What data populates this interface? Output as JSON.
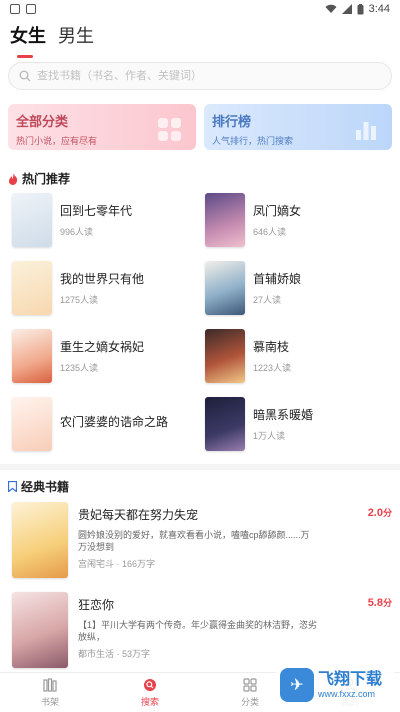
{
  "status_bar": {
    "time": "3:44"
  },
  "gender_tabs": [
    {
      "label": "女生",
      "active": true
    },
    {
      "label": "男生",
      "active": false
    }
  ],
  "search": {
    "placeholder": "查找书籍（书名、作者、关键词）"
  },
  "category_cards": [
    {
      "title": "全部分类",
      "subtitle": "热门小说，应有尽有",
      "color": "#fcc6ce"
    },
    {
      "title": "排行榜",
      "subtitle": "人气排行，热门搜索",
      "color": "#bcd6fa"
    }
  ],
  "hot_section": {
    "title": "热门推荐",
    "books": [
      {
        "name": "回到七零年代",
        "reads": "996人读"
      },
      {
        "name": "凤门嫡女",
        "reads": "646人读"
      },
      {
        "name": "我的世界只有他",
        "reads": "1275人读"
      },
      {
        "name": "首辅娇娘",
        "reads": "27人读"
      },
      {
        "name": "重生之嫡女祸妃",
        "reads": "1235人读"
      },
      {
        "name": "慕南枝",
        "reads": "1223人读"
      },
      {
        "name": "农门婆婆的诰命之路",
        "reads": ""
      },
      {
        "name": "暗黑系暖婚",
        "reads": "1万人读"
      }
    ]
  },
  "classic_section": {
    "title": "经典书籍",
    "books": [
      {
        "title": "贵妃每天都在努力失宠",
        "desc": "圆妗娘没别的爱好，就喜欢看看小说，嗑嗑cp舔舔颜......万万没想到",
        "meta": "宫闱宅斗 · 166万字",
        "score": "2.0",
        "score_unit": "分"
      },
      {
        "title": "狂恋你",
        "desc": "【1】平川大学有两个传奇。年少赢得金曲奖的林洁野，恣劣放纵，",
        "meta": "都市生活 · 53万字",
        "score": "5.8",
        "score_unit": "分"
      }
    ]
  },
  "bottom_nav": [
    {
      "label": "书架",
      "icon": "bookshelf-icon",
      "active": false
    },
    {
      "label": "搜索",
      "icon": "search-icon",
      "active": true
    },
    {
      "label": "分类",
      "icon": "grid-icon",
      "active": false
    },
    {
      "label": "我的",
      "icon": "user-icon",
      "active": false
    }
  ],
  "watermark": {
    "brand": "飞翔下载",
    "url": "www.fxxz.com"
  },
  "colors": {
    "accent": "#e8414a",
    "muted": "#999999"
  }
}
